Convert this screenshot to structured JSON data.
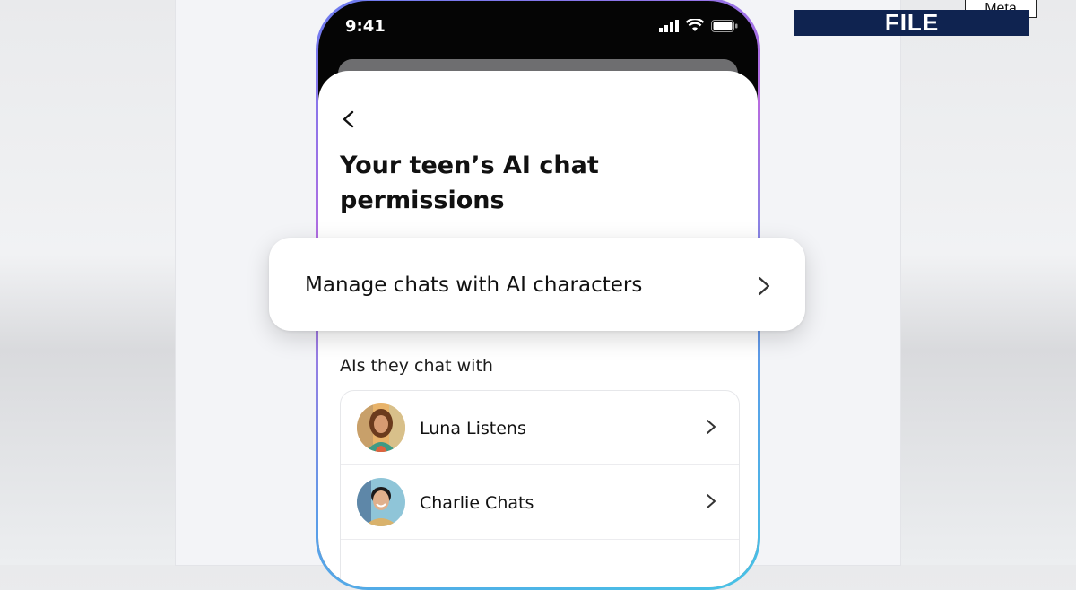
{
  "status_bar": {
    "time": "9:41"
  },
  "screen": {
    "title": "Your teen’s AI chat permissions",
    "manage_card": {
      "label": "Manage chats with AI characters"
    },
    "section_label": "AIs they chat with",
    "ai_list": [
      {
        "name": "Luna Listens",
        "avatar": "woman-portrait"
      },
      {
        "name": "Charlie Chats",
        "avatar": "man-portrait"
      }
    ]
  },
  "overlay": {
    "file_badge": "FILE",
    "watermark": "Meta"
  },
  "colors": {
    "badge_bg": "#0f2350",
    "phone_border_gradient": [
      "#6a7cf0",
      "#b86be0",
      "#46c3e6"
    ]
  }
}
